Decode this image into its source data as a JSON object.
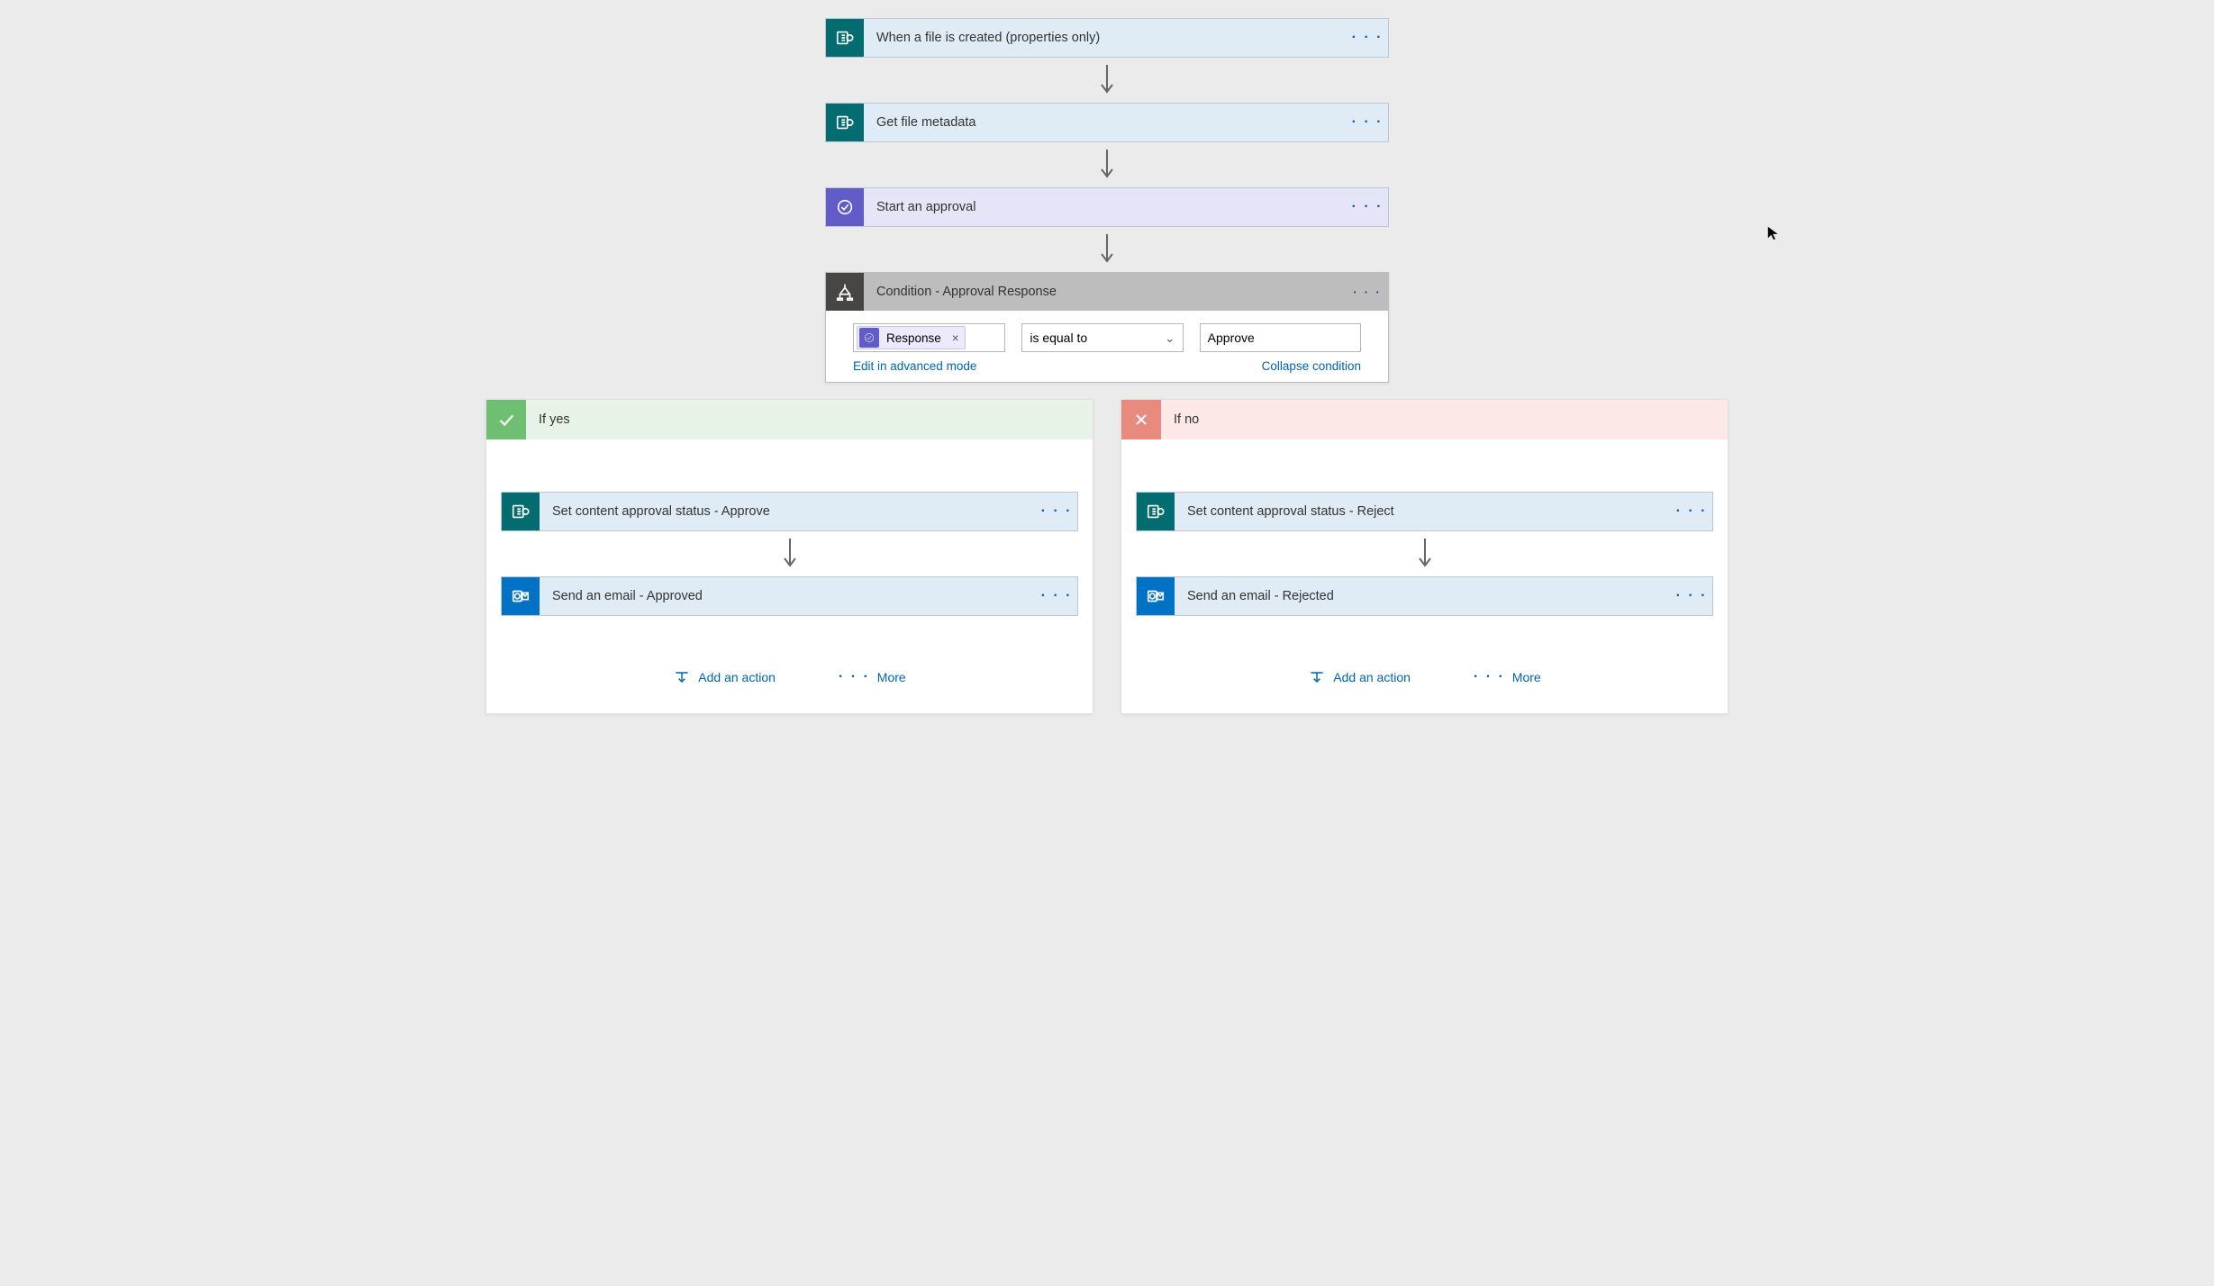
{
  "trigger": {
    "title": "When a file is created (properties only)",
    "icon": "sharepoint-icon"
  },
  "step2": {
    "title": "Get file metadata",
    "icon": "sharepoint-icon"
  },
  "step3": {
    "title": "Start an approval",
    "icon": "approval-icon"
  },
  "condition": {
    "title": "Condition - Approval Response",
    "token_label": "Response",
    "operator": "is equal to",
    "value": "Approve",
    "edit_link": "Edit in advanced mode",
    "collapse_link": "Collapse condition"
  },
  "yes": {
    "header": "If yes",
    "actions": [
      {
        "title": "Set content approval status - Approve",
        "icon": "sharepoint-icon"
      },
      {
        "title": "Send an email - Approved",
        "icon": "outlook-icon"
      }
    ]
  },
  "no": {
    "header": "If no",
    "actions": [
      {
        "title": "Set content approval status - Reject",
        "icon": "sharepoint-icon"
      },
      {
        "title": "Send an email - Rejected",
        "icon": "outlook-icon"
      }
    ]
  },
  "buttons": {
    "add_action": "Add an action",
    "more": "More"
  },
  "colors": {
    "sharepoint": "#036c70",
    "approval": "#615cc7",
    "condition": "#484644",
    "outlook": "#0072c6",
    "link": "#0063b1",
    "yes": "#6fbf73",
    "no": "#e98a7e"
  }
}
